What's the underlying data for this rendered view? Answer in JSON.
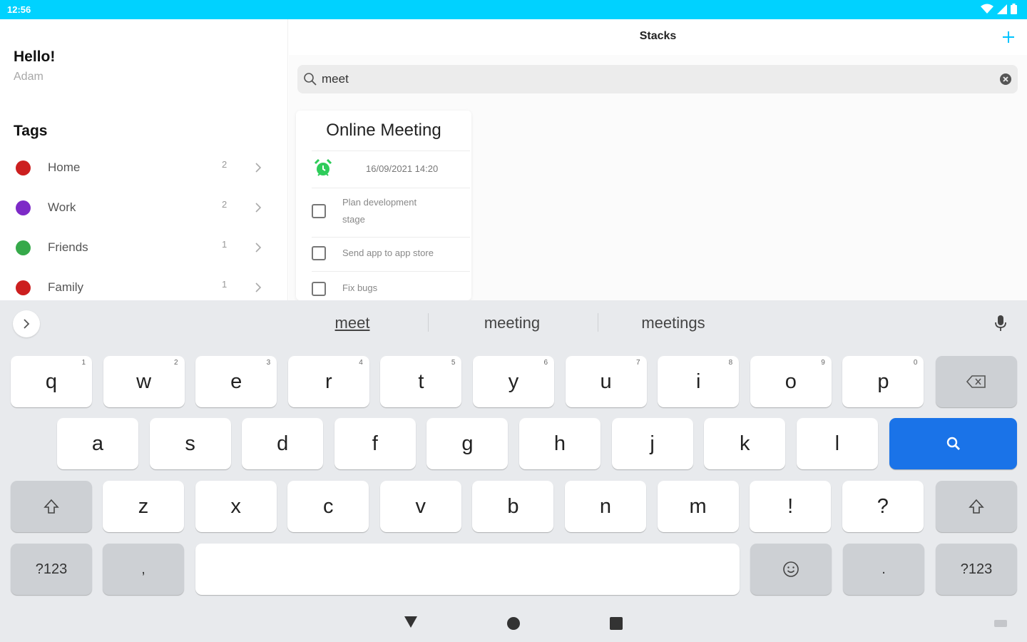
{
  "status_bar": {
    "time": "12:56"
  },
  "sidebar": {
    "greeting": "Hello!",
    "username": "Adam",
    "tags_heading": "Tags",
    "tags": [
      {
        "label": "Home",
        "count": "2",
        "color": "#cc1f1f"
      },
      {
        "label": "Work",
        "count": "2",
        "color": "#7d2ac7"
      },
      {
        "label": "Friends",
        "count": "1",
        "color": "#36a94a"
      },
      {
        "label": "Family",
        "count": "1",
        "color": "#cc1f1f"
      }
    ]
  },
  "header": {
    "title": "Stacks",
    "add_icon": "plus-icon",
    "accent": "#00c4ff"
  },
  "search": {
    "value": "meet",
    "icon": "search-icon",
    "clear_icon": "clear-icon"
  },
  "card": {
    "title": "Online Meeting",
    "alarm_icon": "alarm-clock-icon",
    "alarm_color": "#2ecc5a",
    "date": "16/09/2021 14:20",
    "tasks": [
      {
        "line1": "Plan development",
        "line2": "stage"
      },
      {
        "line1": "Send app to app store",
        "line2": ""
      },
      {
        "line1": "Fix bugs",
        "line2": ""
      }
    ]
  },
  "keyboard": {
    "suggestions": [
      "meet",
      "meeting",
      "meetings"
    ],
    "row1": [
      {
        "char": "q",
        "hint": "1"
      },
      {
        "char": "w",
        "hint": "2"
      },
      {
        "char": "e",
        "hint": "3"
      },
      {
        "char": "r",
        "hint": "4"
      },
      {
        "char": "t",
        "hint": "5"
      },
      {
        "char": "y",
        "hint": "6"
      },
      {
        "char": "u",
        "hint": "7"
      },
      {
        "char": "i",
        "hint": "8"
      },
      {
        "char": "o",
        "hint": "9"
      },
      {
        "char": "p",
        "hint": "0"
      }
    ],
    "row2": [
      "a",
      "s",
      "d",
      "f",
      "g",
      "h",
      "j",
      "k",
      "l"
    ],
    "row3": [
      "z",
      "x",
      "c",
      "v",
      "b",
      "n",
      "m",
      "!",
      "?"
    ],
    "symbols_label": "?123",
    "comma_label": ",",
    "period_label": ".",
    "search_key_color": "#1a73e8"
  }
}
